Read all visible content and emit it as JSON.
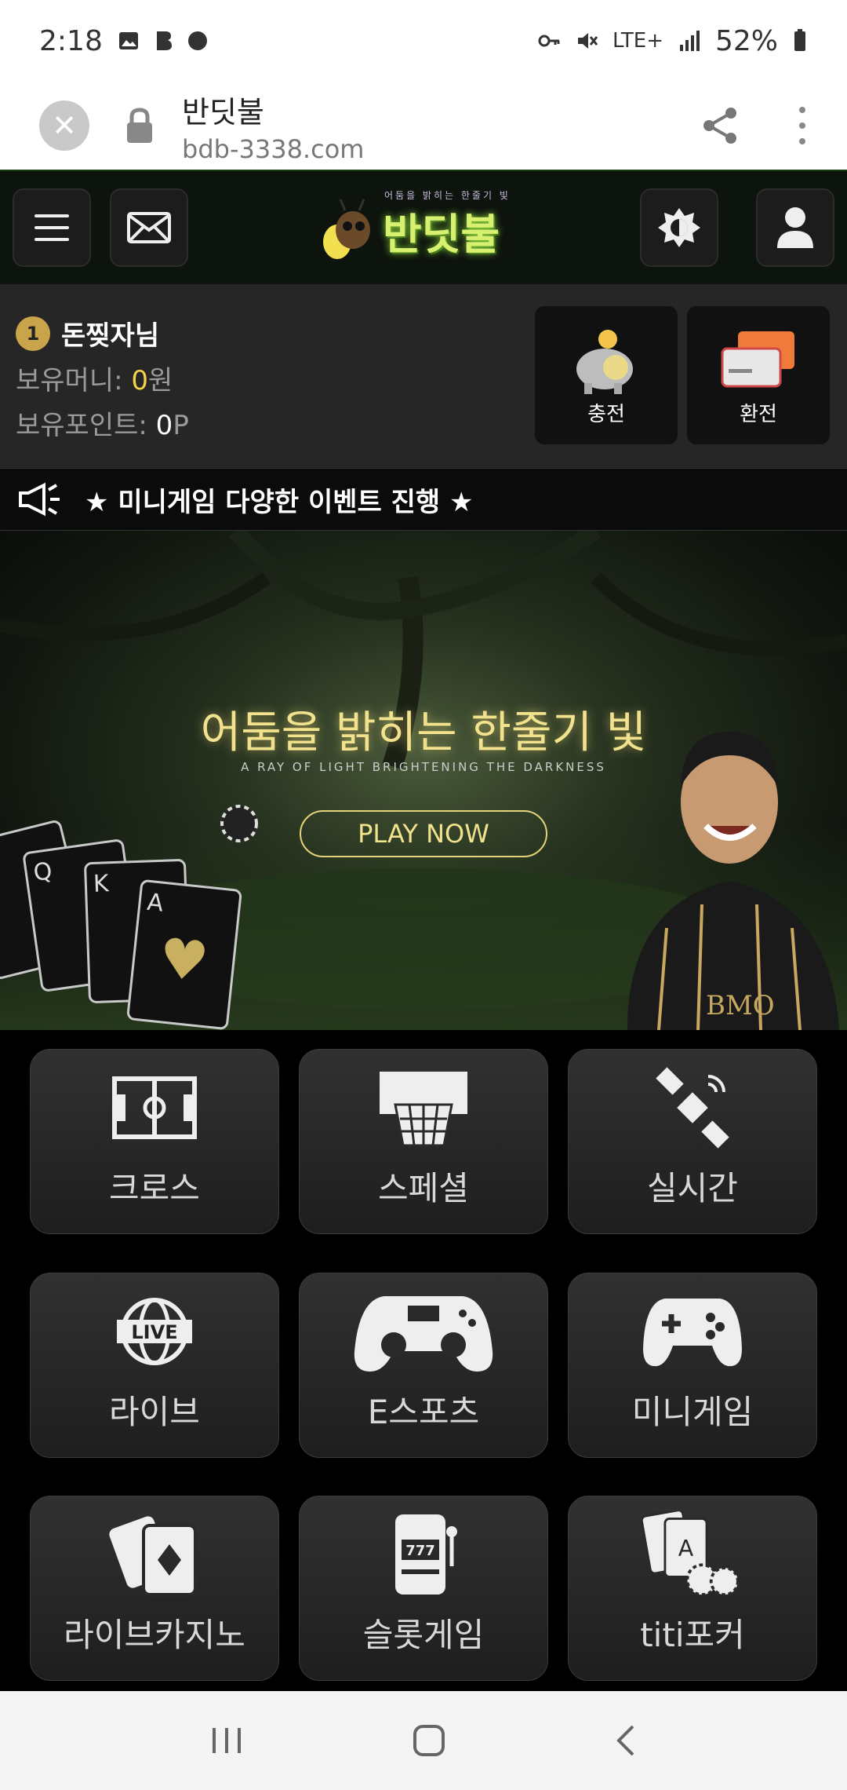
{
  "status_bar": {
    "time": "2:18",
    "network": "LTE+",
    "battery": "52%"
  },
  "browser": {
    "title": "반딧불",
    "url": "bdb-3338.com"
  },
  "header": {
    "logo_text": "반딧불",
    "logo_tagline": "어둠을 밝히는 한줄기 빛"
  },
  "user": {
    "rank": "1",
    "name": "돈찢자님",
    "money_label": "보유머니:",
    "money_value": "0",
    "money_unit": "원",
    "points_label": "보유포인트:",
    "points_value": "0",
    "points_unit": "P",
    "deposit_label": "충전",
    "withdraw_label": "환전"
  },
  "announcement": {
    "text": "★ 미니게임 다양한 이벤트 진행 ★"
  },
  "banner": {
    "title": "어둠을 밝히는 한줄기 빛",
    "subtitle": "A RAY OF LIGHT BRIGHTENING THE DARKNESS",
    "cta": "PLAY NOW"
  },
  "menu": [
    {
      "label": "크로스",
      "icon": "soccer-field-icon"
    },
    {
      "label": "스페셜",
      "icon": "basketball-hoop-icon"
    },
    {
      "label": "실시간",
      "icon": "satellite-icon"
    },
    {
      "label": "라이브",
      "icon": "live-globe-icon"
    },
    {
      "label": "E스포츠",
      "icon": "gamepad-icon"
    },
    {
      "label": "미니게임",
      "icon": "gamepad-small-icon"
    },
    {
      "label": "라이브카지노",
      "icon": "playing-cards-icon"
    },
    {
      "label": "슬롯게임",
      "icon": "slot-machine-icon"
    },
    {
      "label": "titi포커",
      "icon": "poker-chips-icon"
    }
  ]
}
